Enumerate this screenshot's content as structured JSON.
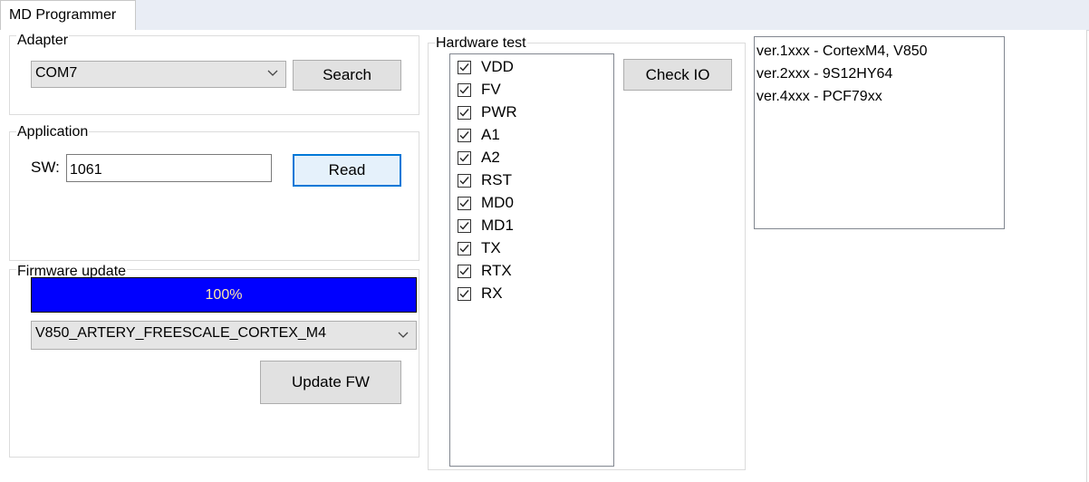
{
  "window": {
    "tab_title": "MD Programmer"
  },
  "adapter": {
    "group_label": "Adapter",
    "port_value": "COM7",
    "search_label": "Search"
  },
  "application": {
    "group_label": "Application",
    "sw_label": "SW:",
    "sw_value": "1061",
    "read_label": "Read"
  },
  "firmware": {
    "group_label": "Firmware update",
    "progress_text": "100%",
    "progress_fraction": 1.0,
    "progress_color": "#0000ff",
    "target_value": "V850_ARTERY_FREESCALE_CORTEX_M4",
    "update_label": "Update FW"
  },
  "hardware": {
    "group_label": "Hardware test",
    "check_io_label": "Check IO",
    "signals": [
      {
        "label": "VDD",
        "checked": true
      },
      {
        "label": "FV",
        "checked": true
      },
      {
        "label": "PWR",
        "checked": true
      },
      {
        "label": "A1",
        "checked": true
      },
      {
        "label": "A2",
        "checked": true
      },
      {
        "label": "RST",
        "checked": true
      },
      {
        "label": "MD0",
        "checked": true
      },
      {
        "label": "MD1",
        "checked": true
      },
      {
        "label": "TX",
        "checked": true
      },
      {
        "label": "RTX",
        "checked": true
      },
      {
        "label": "RX",
        "checked": true
      }
    ]
  },
  "versions": {
    "items": [
      "ver.1xxx - CortexM4, V850",
      "ver.2xxx - 9S12HY64",
      "ver.4xxx - PCF79xx"
    ]
  }
}
